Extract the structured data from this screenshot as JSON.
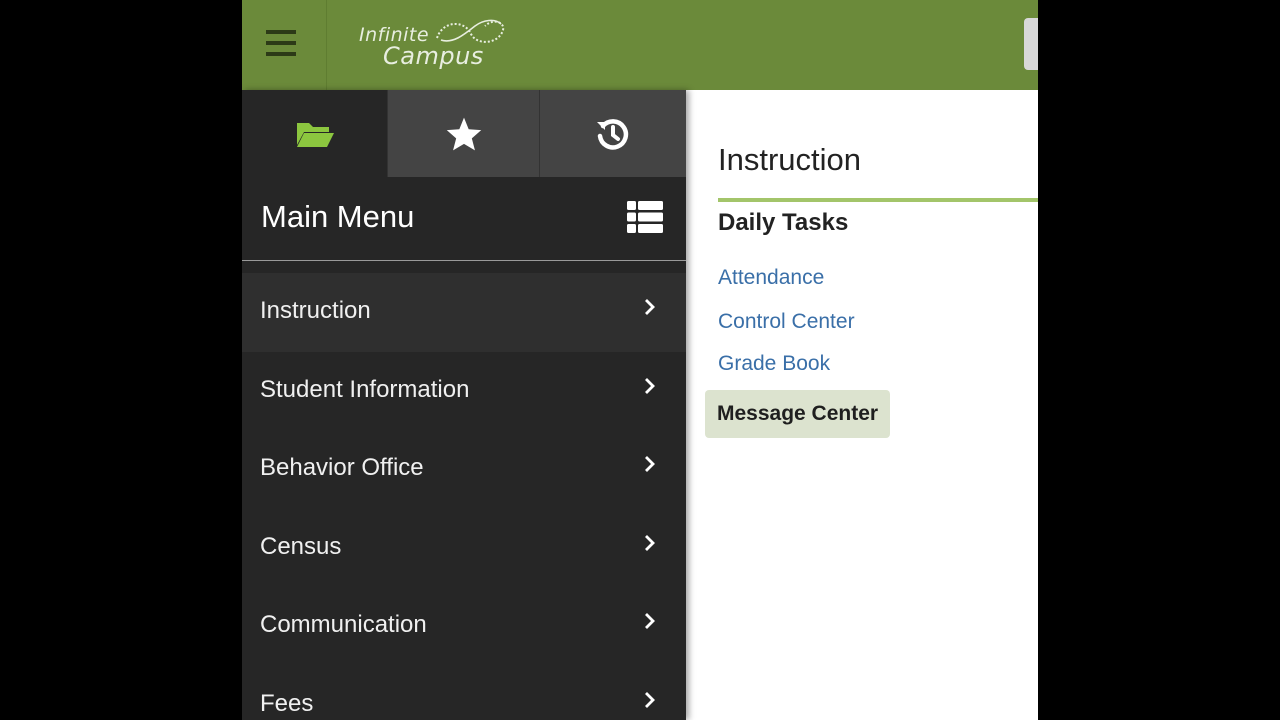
{
  "app": {
    "logo_line1": "Infinite",
    "logo_line2": "Campus",
    "brand_color": "#6b8a3a"
  },
  "topbar": {
    "menu_icon": "hamburger-icon"
  },
  "sidebar": {
    "tabs": [
      {
        "icon": "folder-open-icon",
        "color": "#8cc63f"
      },
      {
        "icon": "star-icon",
        "color": "#ffffff"
      },
      {
        "icon": "history-icon",
        "color": "#ffffff"
      }
    ],
    "title": "Main Menu",
    "title_icon": "list-icon",
    "items": [
      {
        "label": "Instruction"
      },
      {
        "label": "Student Information"
      },
      {
        "label": "Behavior Office"
      },
      {
        "label": "Census"
      },
      {
        "label": "Communication"
      },
      {
        "label": "Fees"
      }
    ]
  },
  "content": {
    "title": "Instruction",
    "section": "Daily Tasks",
    "links": [
      {
        "label": "Attendance"
      },
      {
        "label": "Control Center"
      },
      {
        "label": "Grade Book"
      },
      {
        "label": "Message Center"
      }
    ]
  }
}
